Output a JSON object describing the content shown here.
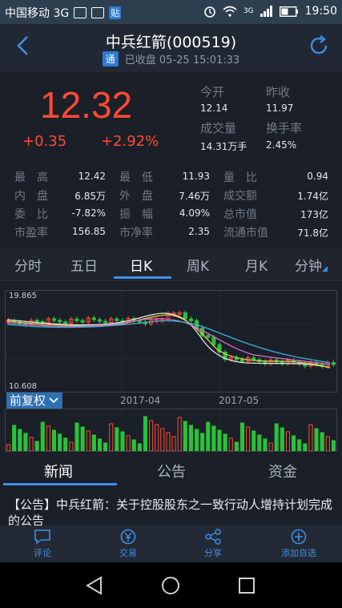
{
  "status_bar": {
    "carrier": "中国移动 3G",
    "time": "19:50",
    "network": "3G"
  },
  "header": {
    "title": "中兵红箭(000519)",
    "badge": "通",
    "status": "已收盘 05-25 15:01:33"
  },
  "quote": {
    "price": "12.32",
    "change": "+0.35",
    "change_pct": "+2.92%"
  },
  "summary": [
    {
      "label": "今开",
      "value": "12.14"
    },
    {
      "label": "昨收",
      "value": "11.97"
    },
    {
      "label": "成交量",
      "value": "14.31万手"
    },
    {
      "label": "换手率",
      "value": "2.45%"
    }
  ],
  "stats": [
    {
      "label": "最　高",
      "value": "12.42"
    },
    {
      "label": "最　低",
      "value": "11.93"
    },
    {
      "label": "量　比",
      "value": "0.94"
    },
    {
      "label": "内　盘",
      "value": "6.85万"
    },
    {
      "label": "外　盘",
      "value": "7.46万"
    },
    {
      "label": "成交额",
      "value": "1.74亿"
    },
    {
      "label": "委　比",
      "value": "-7.82%"
    },
    {
      "label": "振　幅",
      "value": "4.09%"
    },
    {
      "label": "总市值",
      "value": "173亿"
    },
    {
      "label": "市盈率",
      "value": "156.85"
    },
    {
      "label": "市净率",
      "value": "2.35"
    },
    {
      "label": "流通市值",
      "value": "71.8亿"
    }
  ],
  "tabs": [
    "分时",
    "五日",
    "日K",
    "周K",
    "月K",
    "分钟"
  ],
  "chart": {
    "y_max": "19.865",
    "y_min": "10.608",
    "adjust_label": "前复权",
    "date_labels": [
      "2017-04",
      "2017-05"
    ]
  },
  "news_tabs": [
    "新闻",
    "公告",
    "资金"
  ],
  "news_item": "【公告】中兵红箭：关于控股股东之一致行动人增持计划完成的公告",
  "bottom_bar": [
    "评论",
    "交易",
    "分享",
    "添加自选"
  ],
  "colors": {
    "up": "#ff4a35",
    "down": "#2bc13a",
    "accent": "#3d8fe8"
  }
}
